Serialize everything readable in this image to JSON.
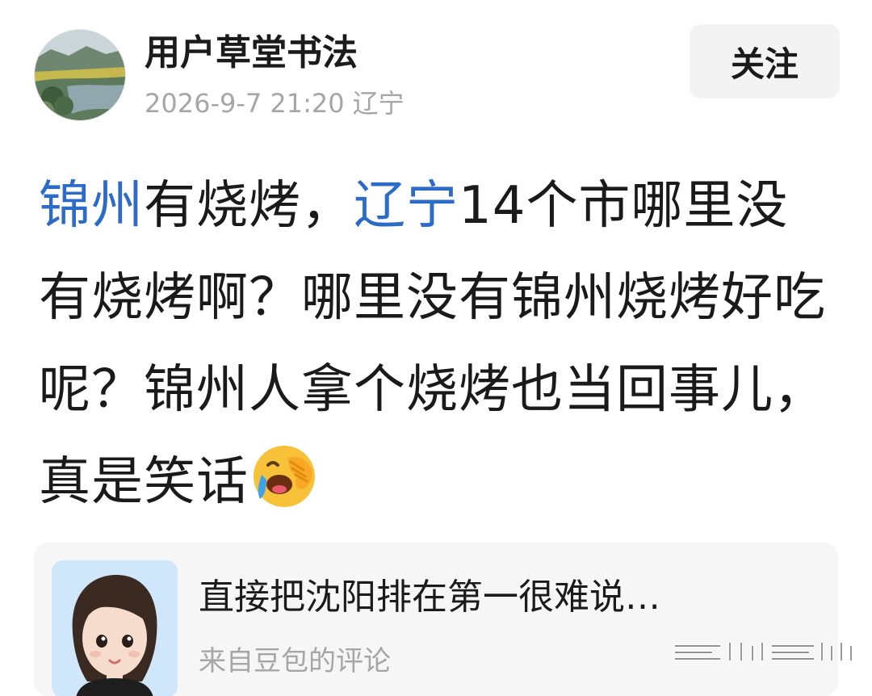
{
  "author": {
    "name": "用户草堂书法",
    "time": "2026-9-7 21:20",
    "location": "辽宁"
  },
  "follow_label": "关注",
  "post": {
    "segments": [
      {
        "text": "锦州",
        "topic": true
      },
      {
        "text": "有烧烤，",
        "topic": false
      },
      {
        "text": "辽宁",
        "topic": true
      },
      {
        "text": "14个市哪里没有烧烤啊？哪里没有锦州烧烤好吃呢？锦州人拿个烧烤也当回事儿，真是笑话",
        "topic": false
      }
    ],
    "emoji": "laughing-crying-emoji"
  },
  "card": {
    "title": "直接把沈阳排在第一很难说…",
    "source": "来自豆包的评论"
  },
  "colors": {
    "topic_blue": "#2c6bc8",
    "meta_gray": "#a6a6a6",
    "card_bg": "#f6f6f6",
    "button_bg": "#f3f3f3"
  },
  "icons": [
    "avatar",
    "laughing-crying-emoji",
    "ai-assistant-avatar",
    "watermark"
  ]
}
